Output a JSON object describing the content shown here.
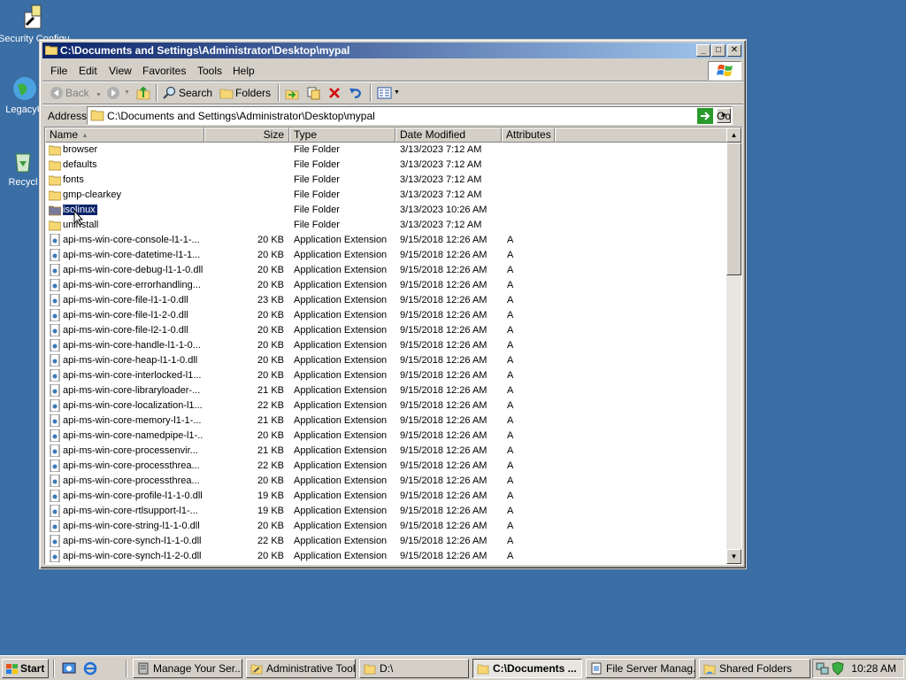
{
  "desktop": {
    "icons": [
      {
        "label": "Security Configu",
        "icon": "security-config-icon"
      },
      {
        "label": "LegacyU",
        "icon": "globe-icon"
      },
      {
        "label": "Recycl",
        "icon": "recycle-bin-icon"
      }
    ]
  },
  "window": {
    "title": "C:\\Documents and Settings\\Administrator\\Desktop\\mypal",
    "controls": {
      "minimize": "_",
      "maximize": "□",
      "close": "✕"
    },
    "menu": [
      "File",
      "Edit",
      "View",
      "Favorites",
      "Tools",
      "Help"
    ],
    "toolbar": {
      "back": "Back",
      "search": "Search",
      "folders": "Folders"
    },
    "address": {
      "label": "Address",
      "value": "C:\\Documents and Settings\\Administrator\\Desktop\\mypal",
      "go": "Go"
    },
    "columns": {
      "name": "Name",
      "size": "Size",
      "type": "Type",
      "date": "Date Modified",
      "attributes": "Attributes"
    },
    "files": [
      {
        "name": "browser",
        "size": "",
        "type": "File Folder",
        "date": "3/13/2023 7:12 AM",
        "attr": "",
        "kind": "folder"
      },
      {
        "name": "defaults",
        "size": "",
        "type": "File Folder",
        "date": "3/13/2023 7:12 AM",
        "attr": "",
        "kind": "folder"
      },
      {
        "name": "fonts",
        "size": "",
        "type": "File Folder",
        "date": "3/13/2023 7:12 AM",
        "attr": "",
        "kind": "folder"
      },
      {
        "name": "gmp-clearkey",
        "size": "",
        "type": "File Folder",
        "date": "3/13/2023 7:12 AM",
        "attr": "",
        "kind": "folder"
      },
      {
        "name": "isolinux",
        "size": "",
        "type": "File Folder",
        "date": "3/13/2023 10:26 AM",
        "attr": "",
        "kind": "folder",
        "selected": true
      },
      {
        "name": "uninstall",
        "size": "",
        "type": "File Folder",
        "date": "3/13/2023 7:12 AM",
        "attr": "",
        "kind": "folder"
      },
      {
        "name": "api-ms-win-core-console-l1-1-...",
        "size": "20 KB",
        "type": "Application Extension",
        "date": "9/15/2018 12:26 AM",
        "attr": "A",
        "kind": "dll"
      },
      {
        "name": "api-ms-win-core-datetime-l1-1...",
        "size": "20 KB",
        "type": "Application Extension",
        "date": "9/15/2018 12:26 AM",
        "attr": "A",
        "kind": "dll"
      },
      {
        "name": "api-ms-win-core-debug-l1-1-0.dll",
        "size": "20 KB",
        "type": "Application Extension",
        "date": "9/15/2018 12:26 AM",
        "attr": "A",
        "kind": "dll"
      },
      {
        "name": "api-ms-win-core-errorhandling...",
        "size": "20 KB",
        "type": "Application Extension",
        "date": "9/15/2018 12:26 AM",
        "attr": "A",
        "kind": "dll"
      },
      {
        "name": "api-ms-win-core-file-l1-1-0.dll",
        "size": "23 KB",
        "type": "Application Extension",
        "date": "9/15/2018 12:26 AM",
        "attr": "A",
        "kind": "dll"
      },
      {
        "name": "api-ms-win-core-file-l1-2-0.dll",
        "size": "20 KB",
        "type": "Application Extension",
        "date": "9/15/2018 12:26 AM",
        "attr": "A",
        "kind": "dll"
      },
      {
        "name": "api-ms-win-core-file-l2-1-0.dll",
        "size": "20 KB",
        "type": "Application Extension",
        "date": "9/15/2018 12:26 AM",
        "attr": "A",
        "kind": "dll"
      },
      {
        "name": "api-ms-win-core-handle-l1-1-0...",
        "size": "20 KB",
        "type": "Application Extension",
        "date": "9/15/2018 12:26 AM",
        "attr": "A",
        "kind": "dll"
      },
      {
        "name": "api-ms-win-core-heap-l1-1-0.dll",
        "size": "20 KB",
        "type": "Application Extension",
        "date": "9/15/2018 12:26 AM",
        "attr": "A",
        "kind": "dll"
      },
      {
        "name": "api-ms-win-core-interlocked-l1...",
        "size": "20 KB",
        "type": "Application Extension",
        "date": "9/15/2018 12:26 AM",
        "attr": "A",
        "kind": "dll"
      },
      {
        "name": "api-ms-win-core-libraryloader-...",
        "size": "21 KB",
        "type": "Application Extension",
        "date": "9/15/2018 12:26 AM",
        "attr": "A",
        "kind": "dll"
      },
      {
        "name": "api-ms-win-core-localization-l1...",
        "size": "22 KB",
        "type": "Application Extension",
        "date": "9/15/2018 12:26 AM",
        "attr": "A",
        "kind": "dll"
      },
      {
        "name": "api-ms-win-core-memory-l1-1-...",
        "size": "21 KB",
        "type": "Application Extension",
        "date": "9/15/2018 12:26 AM",
        "attr": "A",
        "kind": "dll"
      },
      {
        "name": "api-ms-win-core-namedpipe-l1-...",
        "size": "20 KB",
        "type": "Application Extension",
        "date": "9/15/2018 12:26 AM",
        "attr": "A",
        "kind": "dll"
      },
      {
        "name": "api-ms-win-core-processenvir...",
        "size": "21 KB",
        "type": "Application Extension",
        "date": "9/15/2018 12:26 AM",
        "attr": "A",
        "kind": "dll"
      },
      {
        "name": "api-ms-win-core-processthrea...",
        "size": "22 KB",
        "type": "Application Extension",
        "date": "9/15/2018 12:26 AM",
        "attr": "A",
        "kind": "dll"
      },
      {
        "name": "api-ms-win-core-processthrea...",
        "size": "20 KB",
        "type": "Application Extension",
        "date": "9/15/2018 12:26 AM",
        "attr": "A",
        "kind": "dll"
      },
      {
        "name": "api-ms-win-core-profile-l1-1-0.dll",
        "size": "19 KB",
        "type": "Application Extension",
        "date": "9/15/2018 12:26 AM",
        "attr": "A",
        "kind": "dll"
      },
      {
        "name": "api-ms-win-core-rtlsupport-l1-...",
        "size": "19 KB",
        "type": "Application Extension",
        "date": "9/15/2018 12:26 AM",
        "attr": "A",
        "kind": "dll"
      },
      {
        "name": "api-ms-win-core-string-l1-1-0.dll",
        "size": "20 KB",
        "type": "Application Extension",
        "date": "9/15/2018 12:26 AM",
        "attr": "A",
        "kind": "dll"
      },
      {
        "name": "api-ms-win-core-synch-l1-1-0.dll",
        "size": "22 KB",
        "type": "Application Extension",
        "date": "9/15/2018 12:26 AM",
        "attr": "A",
        "kind": "dll"
      },
      {
        "name": "api-ms-win-core-synch-l1-2-0.dll",
        "size": "20 KB",
        "type": "Application Extension",
        "date": "9/15/2018 12:26 AM",
        "attr": "A",
        "kind": "dll"
      }
    ]
  },
  "taskbar": {
    "start": "Start",
    "tasks": [
      {
        "label": "Manage Your Ser...",
        "active": false
      },
      {
        "label": "Administrative Tools",
        "active": false
      },
      {
        "label": "D:\\",
        "active": false
      },
      {
        "label": "C:\\Documents ...",
        "active": true
      },
      {
        "label": "File Server Manag...",
        "active": false
      },
      {
        "label": "Shared Folders",
        "active": false
      }
    ],
    "clock": "10:28 AM"
  },
  "colors": {
    "desktop": "#3a6ea5",
    "titlebar_start": "#0a246a",
    "titlebar_end": "#a6caf0",
    "chrome": "#d4d0c8",
    "selection": "#0a246a"
  }
}
